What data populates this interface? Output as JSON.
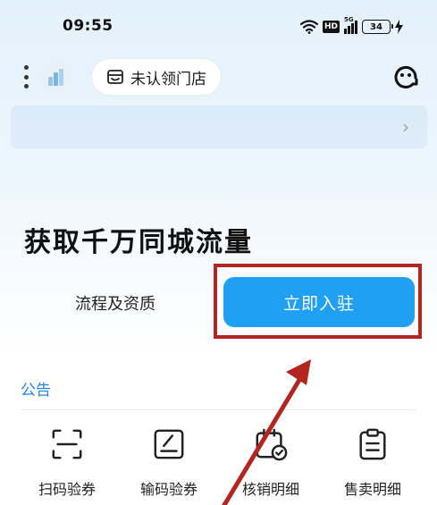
{
  "status_bar": {
    "time": "09:55",
    "hd": "HD",
    "network": "5G",
    "battery": "34"
  },
  "header": {
    "store_chip_label": "未认领门店"
  },
  "hero": {
    "title": "获取千万同城流量",
    "process_link": "流程及资质",
    "join_button": "立即入驻"
  },
  "notice": {
    "label": "公告"
  },
  "shortcuts": [
    {
      "label": "扫码验券",
      "icon": "scan-icon"
    },
    {
      "label": "输码验券",
      "icon": "edit-code-icon"
    },
    {
      "label": "核销明细",
      "icon": "verified-calendar-icon"
    },
    {
      "label": "售卖明细",
      "icon": "clipboard-icon"
    }
  ],
  "colors": {
    "accent": "#1fa0f2",
    "link": "#1f86e6",
    "annotation": "#b5251f"
  }
}
